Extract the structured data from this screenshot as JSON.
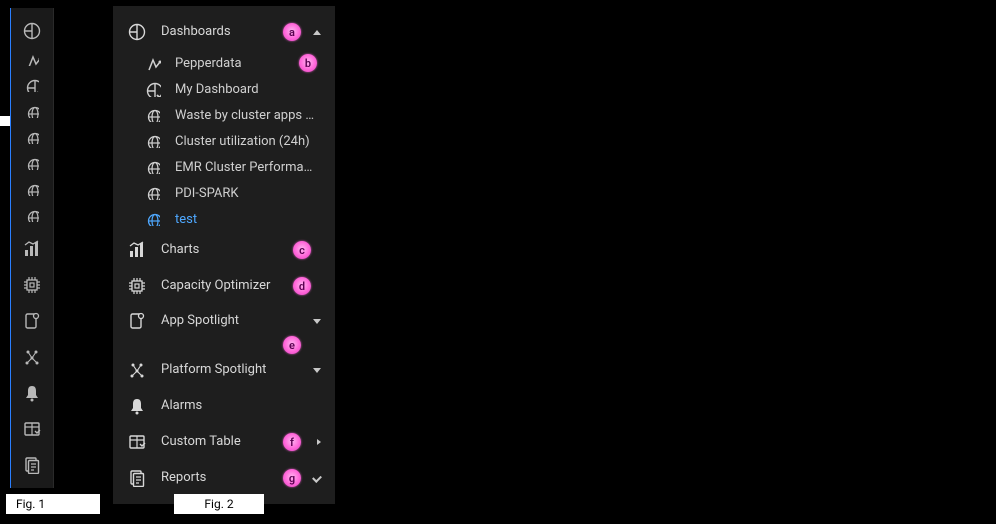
{
  "collapsed_icons": [
    {
      "name": "dashboards-icon"
    },
    {
      "name": "pepperdata-icon"
    },
    {
      "name": "my-dashboard-icon"
    },
    {
      "name": "globe-icon"
    },
    {
      "name": "globe-icon"
    },
    {
      "name": "globe-icon"
    },
    {
      "name": "globe-icon"
    },
    {
      "name": "globe-icon",
      "active": true
    },
    {
      "name": "charts-icon"
    },
    {
      "name": "capacity-optimizer-icon"
    },
    {
      "name": "app-spotlight-icon"
    },
    {
      "name": "platform-spotlight-icon"
    },
    {
      "name": "alarms-icon"
    },
    {
      "name": "custom-table-icon"
    },
    {
      "name": "reports-icon"
    }
  ],
  "nav": {
    "dashboards": {
      "label": "Dashboards",
      "badge": "a",
      "items": [
        {
          "label": "Pepperdata",
          "badge": "b",
          "icon": "pepperdata"
        },
        {
          "label": "My Dashboard",
          "icon": "my-dashboard"
        },
        {
          "label": "Waste by cluster apps (…",
          "icon": "globe"
        },
        {
          "label": "Cluster utilization (24h)",
          "icon": "globe"
        },
        {
          "label": "EMR Cluster Performan…",
          "icon": "globe"
        },
        {
          "label": "PDI-SPARK",
          "icon": "globe"
        },
        {
          "label": "test",
          "icon": "globe",
          "active": true
        }
      ]
    },
    "charts": {
      "label": "Charts",
      "badge": "c"
    },
    "capacity": {
      "label": "Capacity Optimizer",
      "badge": "d"
    },
    "app_spotlight": {
      "label": "App Spotlight",
      "badge": "e"
    },
    "platform_spotlight": {
      "label": "Platform Spotlight"
    },
    "alarms": {
      "label": "Alarms"
    },
    "custom_table": {
      "label": "Custom Table",
      "badge": "f"
    },
    "reports": {
      "label": "Reports",
      "badge": "g"
    }
  },
  "fig1": "Fig. 1",
  "fig2": "Fig. 2"
}
